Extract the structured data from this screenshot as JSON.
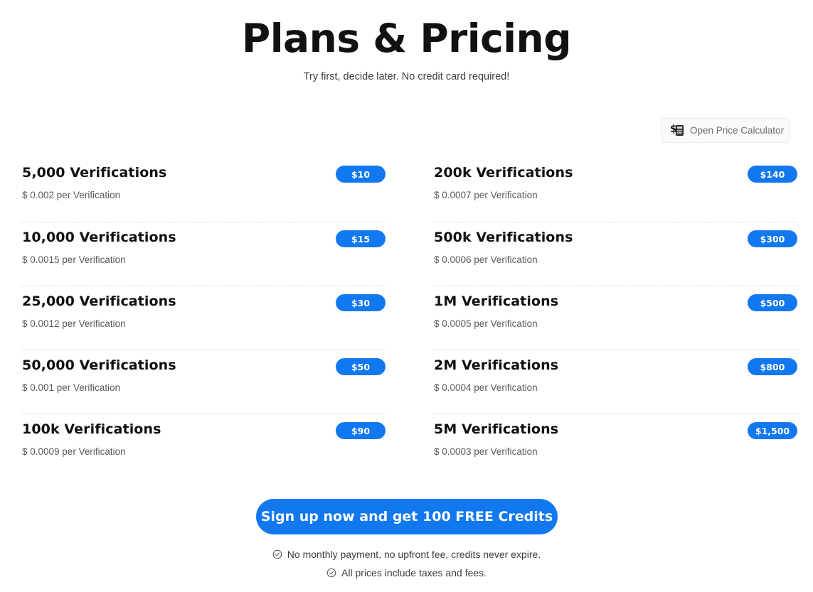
{
  "header": {
    "title": "Plans & Pricing",
    "subtitle": "Try first, decide later. No credit card required!"
  },
  "calculator": {
    "label": "Open Price Calculator",
    "icon": "money-calculator-icon"
  },
  "columns": {
    "left": [
      {
        "name": "5,000 Verifications",
        "unit": "$ 0.002 per Verification",
        "price": "$10"
      },
      {
        "name": "10,000 Verifications",
        "unit": "$ 0.0015 per Verification",
        "price": "$15"
      },
      {
        "name": "25,000 Verifications",
        "unit": "$ 0.0012 per Verification",
        "price": "$30"
      },
      {
        "name": "50,000 Verifications",
        "unit": "$ 0.001 per Verification",
        "price": "$50"
      },
      {
        "name": "100k Verifications",
        "unit": "$ 0.0009 per Verification",
        "price": "$90"
      }
    ],
    "right": [
      {
        "name": "200k Verifications",
        "unit": "$ 0.0007 per Verification",
        "price": "$140"
      },
      {
        "name": "500k Verifications",
        "unit": "$ 0.0006 per Verification",
        "price": "$300"
      },
      {
        "name": "1M Verifications",
        "unit": "$ 0.0005 per Verification",
        "price": "$500"
      },
      {
        "name": "2M Verifications",
        "unit": "$ 0.0004 per Verification",
        "price": "$800"
      },
      {
        "name": "5M Verifications",
        "unit": "$ 0.0003 per Verification",
        "price": "$1,500"
      }
    ]
  },
  "cta": {
    "label": "Sign up now and get 100 FREE Credits"
  },
  "notes": [
    "No monthly payment, no upfront fee, credits never expire.",
    "All prices include taxes and fees."
  ],
  "colors": {
    "accent": "#1178f0",
    "title": "#111111",
    "muted": "#5a5a5a",
    "divider": "#dcdcdc"
  }
}
